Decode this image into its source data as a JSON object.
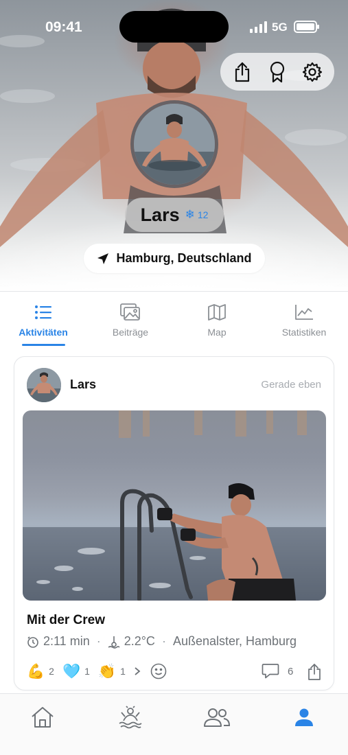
{
  "status_bar": {
    "time": "09:41",
    "network": "5G"
  },
  "profile": {
    "name": "Lars",
    "snow_count": "12",
    "location": "Hamburg, Deutschland"
  },
  "tabs": [
    {
      "label": "Aktivitäten",
      "icon": "list-icon",
      "active": true
    },
    {
      "label": "Beiträge",
      "icon": "photos-icon",
      "active": false
    },
    {
      "label": "Map",
      "icon": "map-icon",
      "active": false
    },
    {
      "label": "Statistiken",
      "icon": "chart-icon",
      "active": false
    }
  ],
  "post": {
    "user": "Lars",
    "time": "Gerade eben",
    "title": "Mit der Crew",
    "duration": "2:11 min",
    "temperature": "2.2°C",
    "place": "Außenalster, Hamburg",
    "reactions": [
      {
        "emoji": "💪",
        "count": "2"
      },
      {
        "emoji": "🩵",
        "count": "1"
      },
      {
        "emoji": "👏",
        "count": "1"
      }
    ],
    "comments": "6"
  },
  "colors": {
    "accent": "#2a84e6",
    "muted": "#8b8f94"
  }
}
